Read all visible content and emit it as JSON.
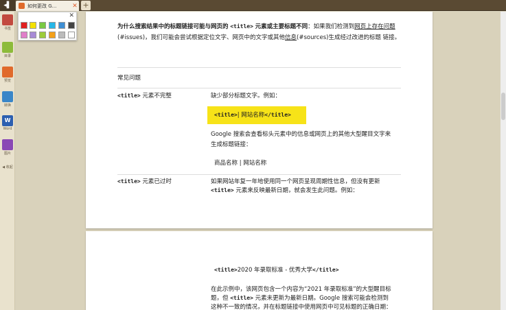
{
  "tabbar": {
    "back_glyph": "◂▌",
    "tab_title": "如何更改 G...",
    "tab_close": "✕",
    "new_tab": "+"
  },
  "sidebar": {
    "items": [
      {
        "label": "书签",
        "color": "#c24a3f",
        "icon": "bookmark-icon"
      },
      {
        "label": "目录",
        "color": "#8dbb3a",
        "icon": "toc-icon"
      },
      {
        "label": "预览",
        "color": "#e06a2b",
        "icon": "preview-icon"
      },
      {
        "label": "转换",
        "color": "#3a86c8",
        "icon": "convert-icon"
      },
      {
        "label": "Word",
        "color": "#2c5fb0",
        "icon": "word-icon",
        "glyph": "W"
      },
      {
        "label": "图片",
        "color": "#8a48b5",
        "icon": "image-icon"
      },
      {
        "label": "◀ 收起",
        "color": "",
        "icon": "collapse-icon"
      }
    ]
  },
  "palette": {
    "close": "✕",
    "colors": [
      "#e02020",
      "#f4e100",
      "#7ac943",
      "#27b7e8",
      "#3f8fd4",
      "#444444",
      "#e07ec9",
      "#a78ad6",
      "#9ccc3a",
      "#f3a01a",
      "#bbbbbb",
      "#ffffff"
    ]
  },
  "page": {
    "intro_bold": "为什么搜索结果中的标题链接可能与网页的",
    "intro_code": "<title>",
    "intro_bold2": "元素或主要标题不同",
    "intro_rest1": "：如果我们检测到",
    "intro_link1": "网页上存在问题",
    "intro_rest2": "(#issues)，我们可能会尝试根据定位文字、网页中的文字或其他",
    "intro_link2": "信息",
    "intro_rest3": "(#sources)生成经过改进的标题",
    "intro_line3": "链接。",
    "faq_heading": "常见问题",
    "row1_code": "<title>",
    "row1_label": "元素不完整",
    "row1_desc": "缺少部分标题文字。例如：",
    "row1_hl_code1": "<title>",
    "row1_hl_text": "| 网站名称",
    "row1_hl_code2": "</title>",
    "row1_para1": "Google 搜索会查看标头元素中的信息或网页上的其他大型醒目文字来",
    "row1_para2": "生成标题链接：",
    "row1_example": "商品名称 | 网站名称",
    "row2_code": "<title>",
    "row2_label": "元素已过时",
    "row2_desc1": "如果网站年复一年地使用同一个网页呈现周期性信息，但没有更新",
    "row2_desc_code": "<title>",
    "row2_desc2": "元素来反映最新日期，就会发生此问题。例如：",
    "p2_code1": "<title>",
    "p2_title": "2020 年录取标准 - 优秀大学",
    "p2_code2": "</title>",
    "p2_para1": "在此示例中，该网页包含一个内容为“2021 年录取标准”的大型醒目标",
    "p2_para2a": "题，但",
    "p2_para2_code": "<title>",
    "p2_para2b": "元素未更新为最新日期。Google 搜索可能会检测到",
    "p2_para3": "这种不一致的情况，并在标题链接中使用网页中可见标题的正确日期："
  }
}
